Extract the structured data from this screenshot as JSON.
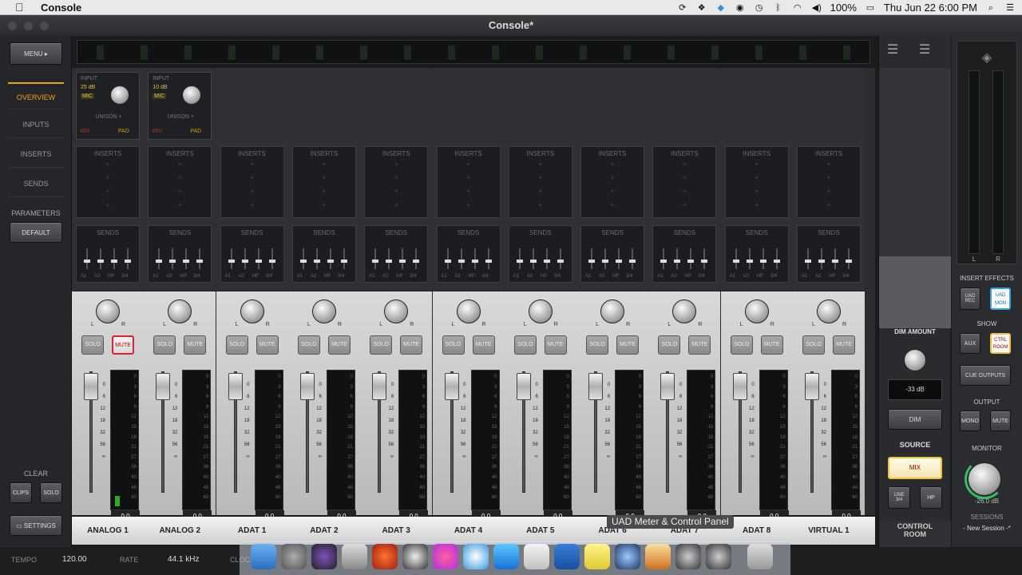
{
  "menubar": {
    "app_name": "Console",
    "status": {
      "battery": "100%",
      "clock": "Thu Jun 22  6:00 PM"
    }
  },
  "window": {
    "title": "Console*"
  },
  "left_nav": {
    "menu_label": "MENU",
    "items": [
      "OVERVIEW",
      "INPUTS",
      "INSERTS",
      "SENDS"
    ],
    "parameters_label": "PARAMETERS",
    "default_label": "DEFAULT",
    "clear_label": "CLEAR",
    "clips_label": "CLIPS",
    "solo_label": "SOLO",
    "settings_label": "SETTINGS"
  },
  "channels": [
    {
      "name": "ANALOG 1",
      "preamp": {
        "input": "INPUT",
        "gain": "25 dB",
        "type": "MIC",
        "unison": "UNISON +"
      },
      "muted": true,
      "level": "0.0",
      "meter_fill": 0.08
    },
    {
      "name": "ANALOG 2",
      "preamp": {
        "input": "INPUT",
        "gain": "10 dB",
        "type": "MIC",
        "unison": "UNISON +"
      },
      "muted": false,
      "level": "0.0",
      "meter_fill": 0
    },
    {
      "name": "ADAT 1",
      "muted": false,
      "level": "0.0",
      "meter_fill": 0
    },
    {
      "name": "ADAT 2",
      "muted": false,
      "level": "0.0",
      "meter_fill": 0
    },
    {
      "name": "ADAT 3",
      "muted": false,
      "level": "0.0",
      "meter_fill": 0
    },
    {
      "name": "ADAT 4",
      "muted": false,
      "level": "0.0",
      "meter_fill": 0
    },
    {
      "name": "ADAT 5",
      "muted": false,
      "level": "0.0",
      "meter_fill": 0
    },
    {
      "name": "ADAT 6",
      "muted": false,
      "level": "0.0",
      "meter_fill": 0
    },
    {
      "name": "ADAT 7",
      "muted": false,
      "level": "0.0",
      "meter_fill": 0
    },
    {
      "name": "ADAT 8",
      "muted": false,
      "level": "0.0",
      "meter_fill": 0
    },
    {
      "name": "VIRTUAL 1",
      "muted": false,
      "level": "0.0",
      "meter_fill": 0
    }
  ],
  "strip_labels": {
    "inserts": "INSERTS",
    "sends": "SENDS",
    "solo": "SOLO",
    "mute": "MUTE",
    "send_names": [
      "A1",
      "A2",
      "HP",
      "3/4"
    ],
    "pan_l": "L",
    "pan_r": "R",
    "preamp_flags": [
      "48V",
      "PAD"
    ]
  },
  "fader_scale": [
    "0",
    "6",
    "12",
    "18",
    "32",
    "56",
    "∞"
  ],
  "meter_scale": [
    "0",
    "3",
    "6",
    "9",
    "12",
    "15",
    "18",
    "21",
    "27",
    "36",
    "40",
    "48",
    "60"
  ],
  "monitor": {
    "dim_amount_label": "DIM AMOUNT",
    "dim_value": "-33 dB",
    "dim_label": "DIM",
    "source_label": "SOURCE",
    "mix_label": "MIX",
    "line_label": "LINE 3/4",
    "hp_label": "HP",
    "control_room_label": "CONTROL ROOM"
  },
  "right_panel": {
    "meter_l": "L",
    "meter_r": "R",
    "insert_effects_label": "INSERT EFFECTS",
    "uad_rec_label": "UAD REC",
    "uad_mon_label": "UAD MON",
    "show_label": "SHOW",
    "aux_label": "AUX",
    "ctrl_room_label": "CTRL ROOM",
    "cue_outputs_label": "CUE OUTPUTS",
    "output_label": "OUTPUT",
    "mono_label": "MONO",
    "mute_label": "MUTE",
    "monitor_label": "MONITOR",
    "monitor_value": "-26.0 dB",
    "sessions_label": "SESSIONS",
    "session_name": "- New Session -*"
  },
  "bottom": {
    "tempo_label": "TEMPO",
    "tempo_value": "120.00",
    "rate_label": "RATE",
    "rate_value": "44.1 kHz",
    "clock_label": "CLOCK"
  },
  "tooltip": "UAD Meter & Control Panel",
  "colors": {
    "accent": "#f0a020",
    "mute_on": "#d22233",
    "mix_on": "#f0c040",
    "uad_mon": "#3aa0e0"
  }
}
